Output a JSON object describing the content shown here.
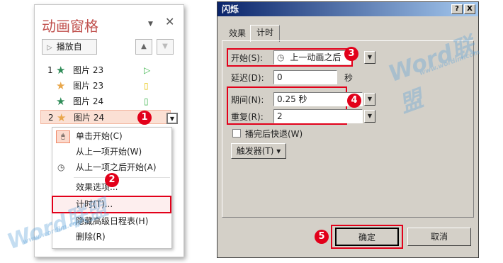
{
  "pane": {
    "title": "动画窗格",
    "dropdown_glyph": "▼",
    "close_glyph": "✕",
    "play_label": "播放自",
    "rows": [
      {
        "num": "1",
        "star": "★",
        "star_color": "#2e8b57",
        "name": "图片 23",
        "mark": "▷",
        "mark_color": "#3cb44b"
      },
      {
        "num": "",
        "star": "★",
        "star_color": "#e8a64a",
        "name": "图片 23",
        "mark": "▯",
        "mark_color": "#e6c200"
      },
      {
        "num": "",
        "star": "★",
        "star_color": "#2e8b57",
        "name": "图片 24",
        "mark": "▯",
        "mark_color": "#3cb44b"
      },
      {
        "num": "2",
        "star": "★",
        "star_color": "#e8a64a",
        "name": "图片 24",
        "mark": "",
        "mark_color": "#3cb44b"
      }
    ]
  },
  "menu": {
    "items": [
      "单击开始(C)",
      "从上一项开始(W)",
      "从上一项之后开始(A)",
      "效果选项...",
      "计时(T)...",
      "隐藏高级日程表(H)",
      "删除(R)"
    ]
  },
  "dialog": {
    "title": "闪烁",
    "help_glyph": "?",
    "close_glyph": "X",
    "tabs": [
      "效果",
      "计时"
    ],
    "start_label": "开始(S):",
    "start_value": "上一动画之后",
    "delay_label": "延迟(D):",
    "delay_value": "0",
    "delay_unit": "秒",
    "period_label": "期间(N):",
    "period_value": "0.25 秒",
    "repeat_label": "重复(R):",
    "repeat_value": "2",
    "rewind_label": "播完后快退(W)",
    "trigger_label": "触发器(T) ▾",
    "ok_label": "确定",
    "cancel_label": "取消"
  },
  "callouts": [
    "1",
    "2",
    "3",
    "4",
    "5"
  ],
  "watermark": {
    "text": "Word联盟",
    "url": "www.wordlm.com"
  },
  "colors": {
    "accent": "#e2001a",
    "pane_title": "#c0504d",
    "titlebar": "#0a246a"
  }
}
